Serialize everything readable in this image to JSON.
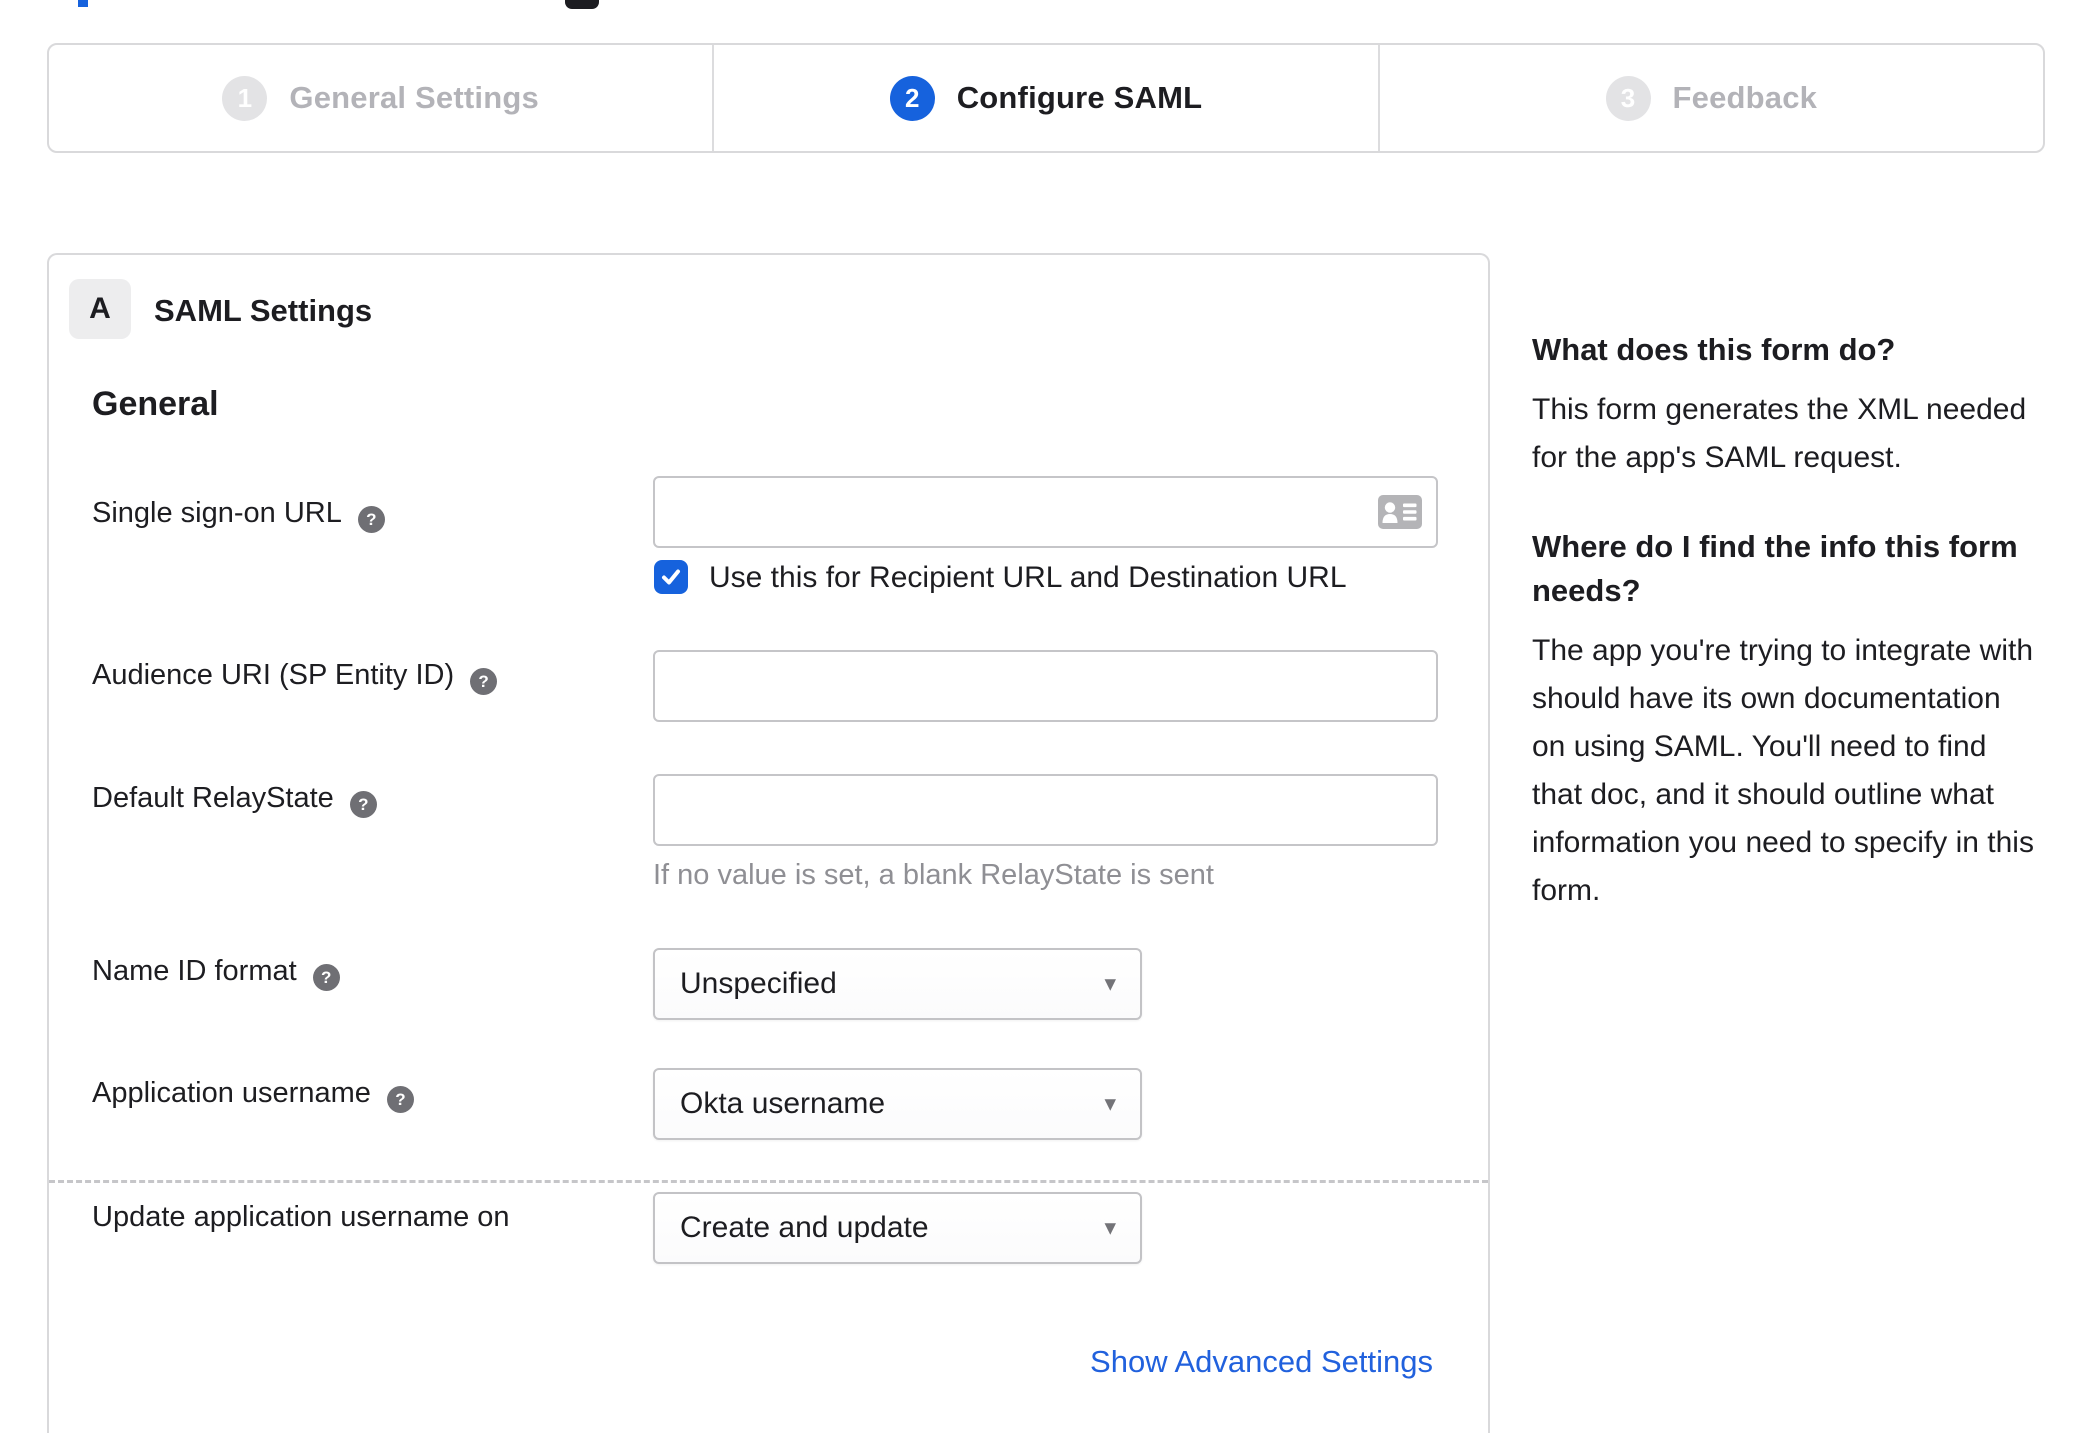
{
  "colors": {
    "accent_blue": "#1662dd",
    "text_dark": "#1d1d21",
    "muted_gray": "#8f8f94",
    "border_gray": "#d9d9db",
    "inactive_step_gray": "#b3b3b8"
  },
  "stepper": {
    "steps": [
      {
        "number": "1",
        "label": "General Settings",
        "state": "inactive"
      },
      {
        "number": "2",
        "label": "Configure SAML",
        "state": "active"
      },
      {
        "number": "3",
        "label": "Feedback",
        "state": "inactive"
      }
    ]
  },
  "panel": {
    "section_badge": "A",
    "section_title": "SAML Settings",
    "group_heading": "General",
    "help_glyph": "?",
    "caret_glyph": "▾",
    "fields": {
      "sso_url": {
        "label": "Single sign-on URL",
        "value": "",
        "checkbox_label": "Use this for Recipient URL and Destination URL",
        "checkbox_checked": true
      },
      "audience_uri": {
        "label": "Audience URI (SP Entity ID)",
        "value": ""
      },
      "relay_state": {
        "label": "Default RelayState",
        "value": "",
        "hint": "If no value is set, a blank RelayState is sent"
      },
      "name_id_format": {
        "label": "Name ID format",
        "value": "Unspecified"
      },
      "app_username": {
        "label": "Application username",
        "value": "Okta username"
      },
      "update_username_on": {
        "label": "Update application username on",
        "value": "Create and update"
      }
    },
    "advanced_link": "Show Advanced Settings"
  },
  "sidebar": {
    "sections": [
      {
        "heading": "What does this form do?",
        "body": "This form generates the XML needed for the app's SAML request."
      },
      {
        "heading": "Where do I find the info this form needs?",
        "body": "The app you're trying to integrate with should have its own documentation on using SAML. You'll need to find that doc, and it should outline what information you need to specify in this form."
      }
    ]
  }
}
